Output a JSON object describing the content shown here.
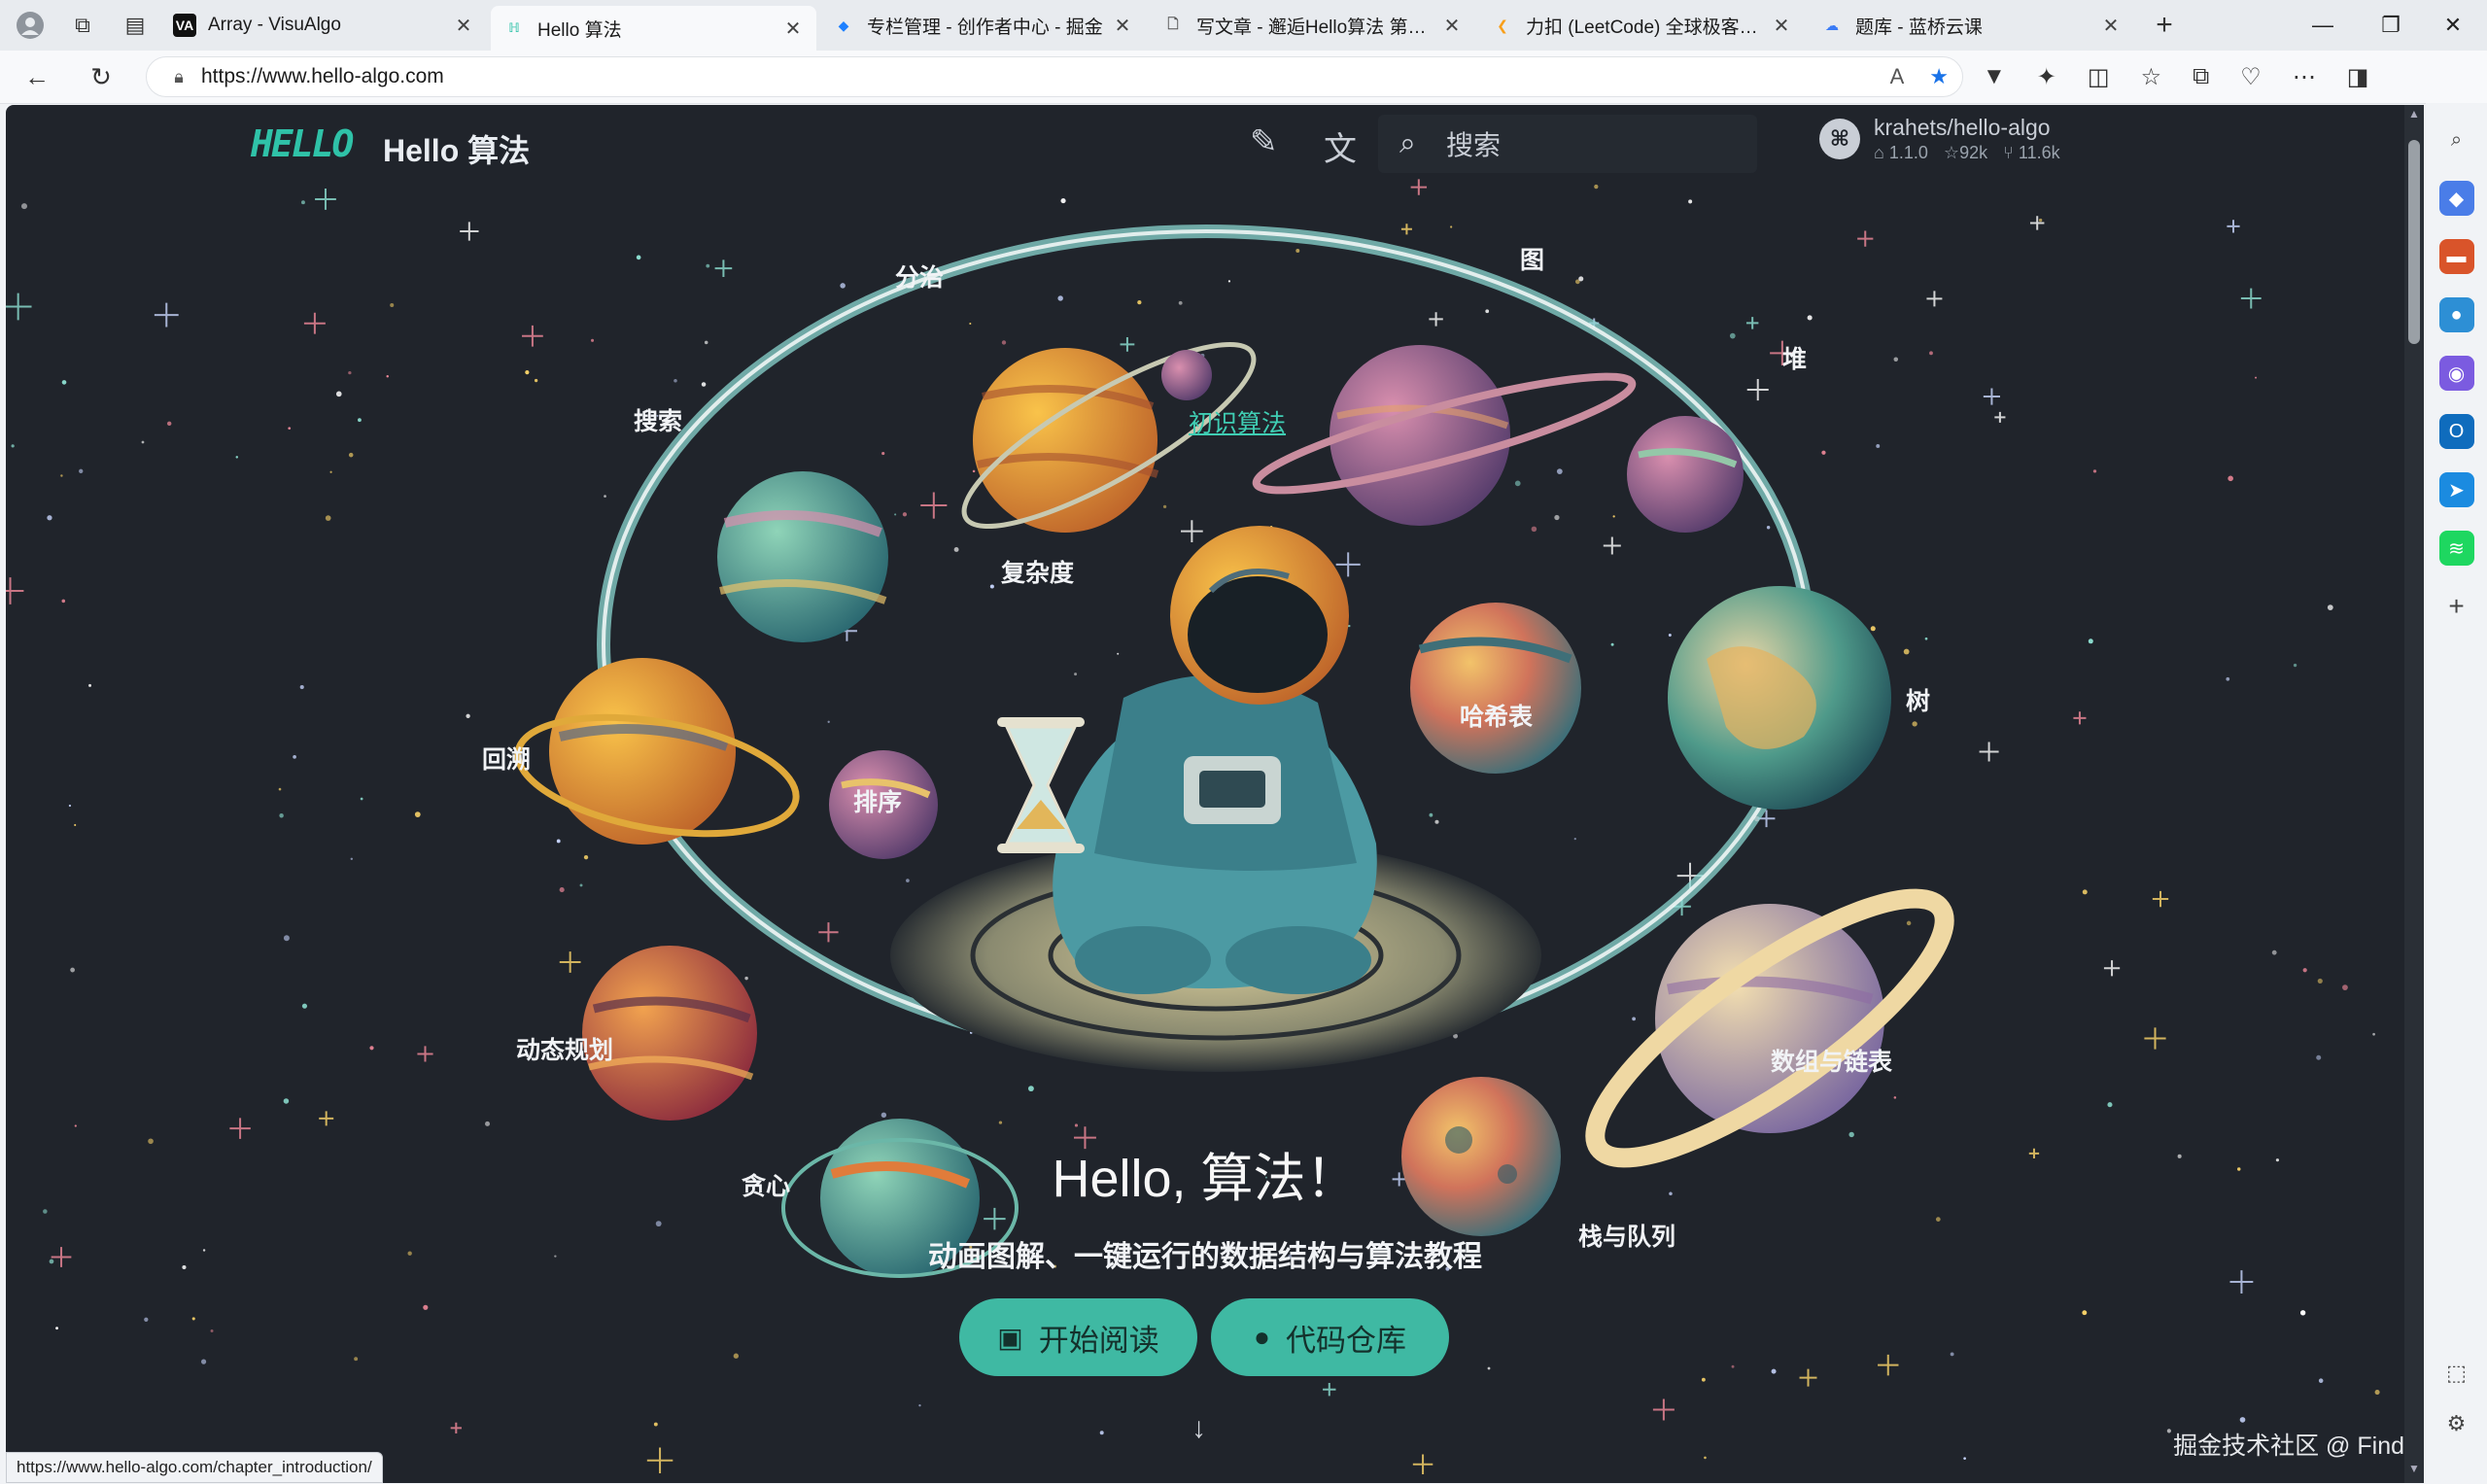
{
  "browser": {
    "tabs": [
      {
        "title": "Array - VisuAlgo",
        "favicon": "VA",
        "color": "#111111",
        "active": false
      },
      {
        "title": "Hello 算法",
        "favicon": "hello-algo-logo",
        "color": "#2fc2a8",
        "active": true
      },
      {
        "title": "专栏管理 - 创作者中心 - 掘金",
        "favicon": "juejin-logo",
        "color": "#1e80ff",
        "active": false
      },
      {
        "title": "写文章 - 邂逅Hello算法 第一篇",
        "favicon": "document-icon",
        "color": "#555555",
        "active": false
      },
      {
        "title": "力扣 (LeetCode) 全球极客挚爱",
        "favicon": "leetcode-logo",
        "color": "#f89f1b",
        "active": false
      },
      {
        "title": "题库 - 蓝桥云课",
        "favicon": "lanqiao-logo",
        "color": "#3a7bf6",
        "active": false
      }
    ],
    "new_tab_label": "+",
    "url": "https://www.hello-algo.com",
    "status_url": "https://www.hello-algo.com/chapter_introduction/"
  },
  "site": {
    "logo_text": "HELLO",
    "title": "Hello 算法",
    "search_placeholder": "搜索",
    "repo": {
      "name": "krahets/hello-algo",
      "version": "1.1.0",
      "stars": "92k",
      "forks": "11.6k"
    }
  },
  "hero": {
    "center_link": "初识算法",
    "labels": {
      "divide": "分治",
      "graph": "图",
      "heap": "堆",
      "search": "搜索",
      "complexity": "复杂度",
      "hash": "哈希表",
      "tree": "树",
      "backtrack": "回溯",
      "sort": "排序",
      "dp": "动态规划",
      "array_list": "数组与链表",
      "greedy": "贪心",
      "stack_queue": "栈与队列"
    },
    "title": "Hello, 算法！",
    "subtitle": "动画图解、一键运行的数据结构与算法教程",
    "start_button": "开始阅读",
    "repo_button": "代码仓库"
  },
  "watermark": "掘金技术社区 @ Find",
  "colors": {
    "accent": "#3fb9a3",
    "page_bg": "#20242b",
    "link": "#3fcdb3"
  }
}
